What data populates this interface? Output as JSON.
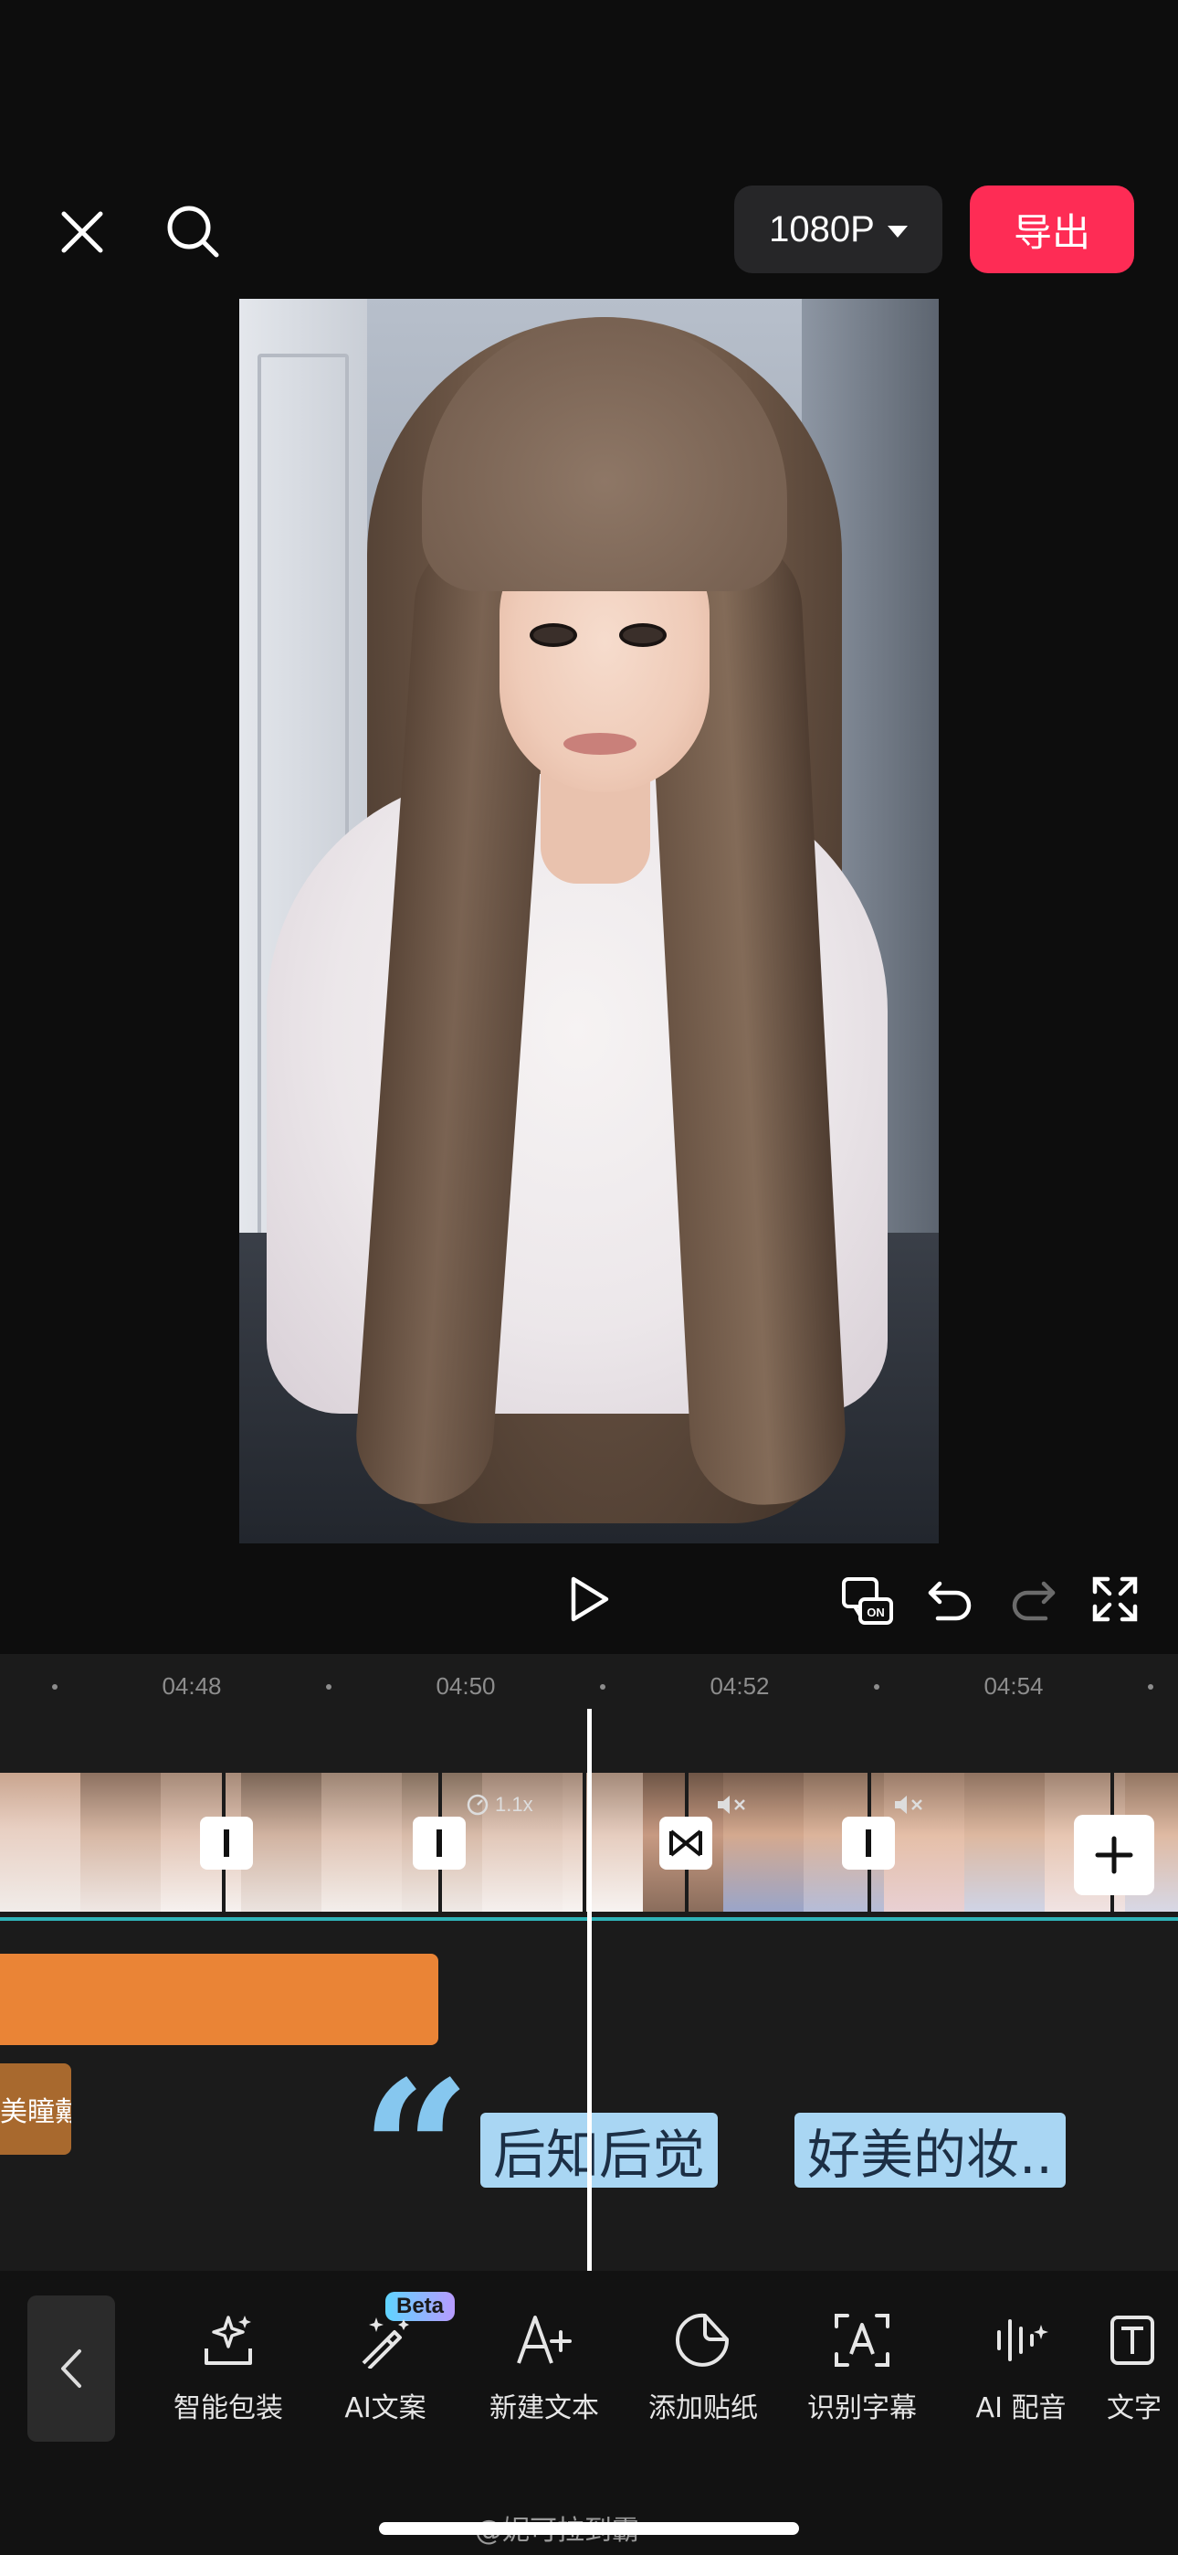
{
  "header": {
    "resolution_label": "1080P",
    "export_label": "导出"
  },
  "timeline": {
    "ruler_ticks": [
      "04:48",
      "04:50",
      "04:52",
      "04:54"
    ],
    "speed_badge": "1.1x",
    "text_clip_label": "美瞳戴"
  },
  "overlay": {
    "caption_part1": "后知后觉",
    "caption_part2": "好美的妆..",
    "quote_mark": "“"
  },
  "toolbar": {
    "beta_badge": "Beta",
    "items": [
      {
        "label": "智能包装",
        "icon": "sparkle-box-icon"
      },
      {
        "label": "AI文案",
        "icon": "magic-wand-icon"
      },
      {
        "label": "新建文本",
        "icon": "text-plus-icon"
      },
      {
        "label": "添加贴纸",
        "icon": "sticker-icon"
      },
      {
        "label": "识别字幕",
        "icon": "caption-scan-icon"
      },
      {
        "label": "AI 配音",
        "icon": "voice-wave-icon"
      },
      {
        "label": "文字",
        "icon": "text-template-icon"
      }
    ]
  },
  "watermark": "@妮可拉到霸",
  "colors": {
    "export_red": "#fe2c55",
    "timeline_teal": "#2fb3b8",
    "audio_orange": "#ea8436",
    "caption_blue": "#a9d6f3"
  }
}
